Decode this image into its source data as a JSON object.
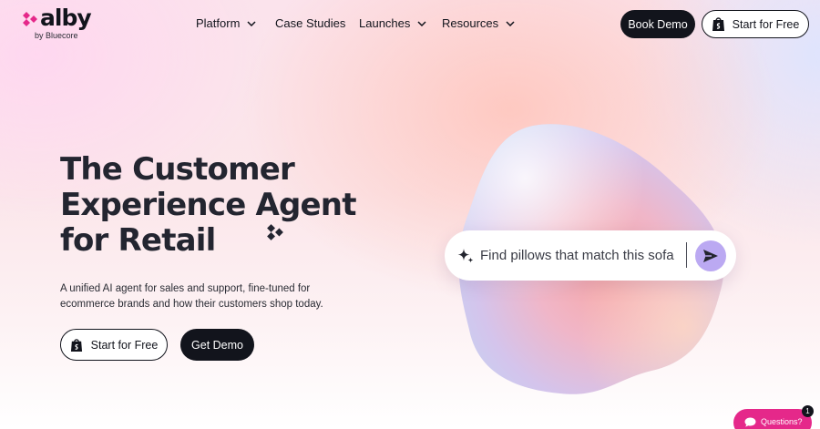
{
  "brand": {
    "name": "alby",
    "sub": "by Bluecore",
    "accent_color": "#e5288a"
  },
  "nav": {
    "items": [
      {
        "label": "Platform",
        "has_dropdown": true
      },
      {
        "label": "Case Studies",
        "has_dropdown": false
      },
      {
        "label": "Launches",
        "has_dropdown": true
      },
      {
        "label": "Resources",
        "has_dropdown": true
      }
    ],
    "book_demo": "Book Demo",
    "start_free": "Start for Free"
  },
  "hero": {
    "headline_lines": [
      "The Customer",
      "Experience Agent",
      "for Retail"
    ],
    "subtext": "A unified AI agent for sales and support, fine-tuned for ecommerce brands and how their customers shop today.",
    "cta_primary": "Start for Free",
    "cta_secondary": "Get Demo"
  },
  "search": {
    "placeholder": "Find pillows that match this sofa",
    "icon": "sparkle-icon",
    "send_icon": "send-icon",
    "send_color": "#bba9f2"
  },
  "widget": {
    "label": "Questions?",
    "badge": "1",
    "icon": "chat-bubble-icon"
  }
}
